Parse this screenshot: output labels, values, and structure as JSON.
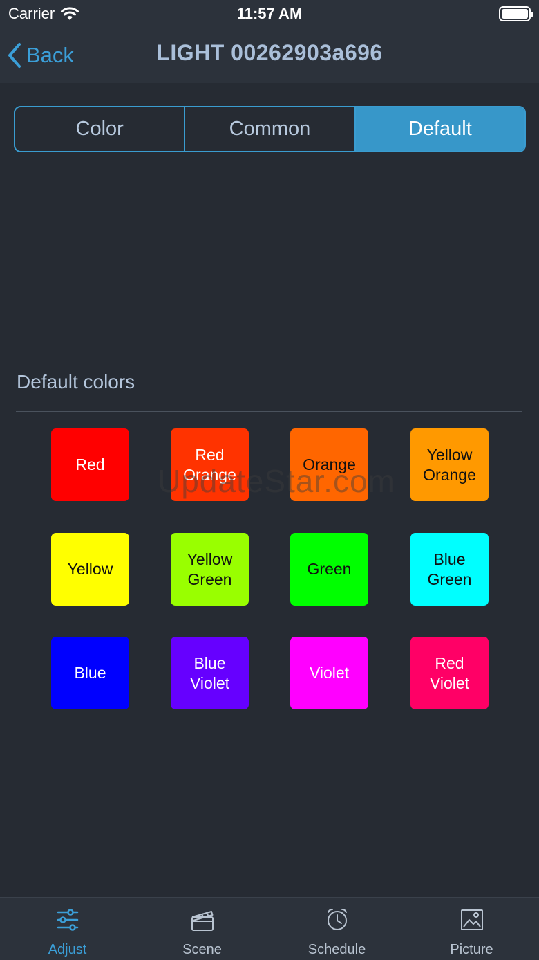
{
  "status_bar": {
    "carrier": "Carrier",
    "time": "11:57 AM"
  },
  "nav": {
    "back_label": "Back",
    "title": "LIGHT 00262903a696"
  },
  "segments": [
    {
      "label": "Color",
      "active": false
    },
    {
      "label": "Common",
      "active": false
    },
    {
      "label": "Default",
      "active": true
    }
  ],
  "section": {
    "title": "Default colors"
  },
  "colors": [
    {
      "label": "Red",
      "bg": "#ff0000",
      "fg": "#ffffff"
    },
    {
      "label": "Red\nOrange",
      "bg": "#ff3300",
      "fg": "#ffffff"
    },
    {
      "label": "Orange",
      "bg": "#ff6600",
      "fg": "#111111"
    },
    {
      "label": "Yellow\nOrange",
      "bg": "#ff9900",
      "fg": "#111111"
    },
    {
      "label": "Yellow",
      "bg": "#ffff00",
      "fg": "#111111"
    },
    {
      "label": "Yellow\nGreen",
      "bg": "#99ff00",
      "fg": "#111111"
    },
    {
      "label": "Green",
      "bg": "#00ff00",
      "fg": "#111111"
    },
    {
      "label": "Blue\nGreen",
      "bg": "#00ffff",
      "fg": "#111111"
    },
    {
      "label": "Blue",
      "bg": "#0000ff",
      "fg": "#ffffff"
    },
    {
      "label": "Blue\nViolet",
      "bg": "#6600ff",
      "fg": "#ffffff"
    },
    {
      "label": "Violet",
      "bg": "#ff00ff",
      "fg": "#ffffff"
    },
    {
      "label": "Red\nViolet",
      "bg": "#ff0066",
      "fg": "#ffffff"
    }
  ],
  "watermark": "UpdateStar.com",
  "tabs": [
    {
      "label": "Adjust",
      "icon": "sliders-icon",
      "active": true
    },
    {
      "label": "Scene",
      "icon": "clapperboard-icon",
      "active": false
    },
    {
      "label": "Schedule",
      "icon": "alarm-clock-icon",
      "active": false
    },
    {
      "label": "Picture",
      "icon": "image-icon",
      "active": false
    }
  ],
  "theme": {
    "accent": "#3b9fd8",
    "background": "#262b33",
    "bar": "#2c323b"
  }
}
